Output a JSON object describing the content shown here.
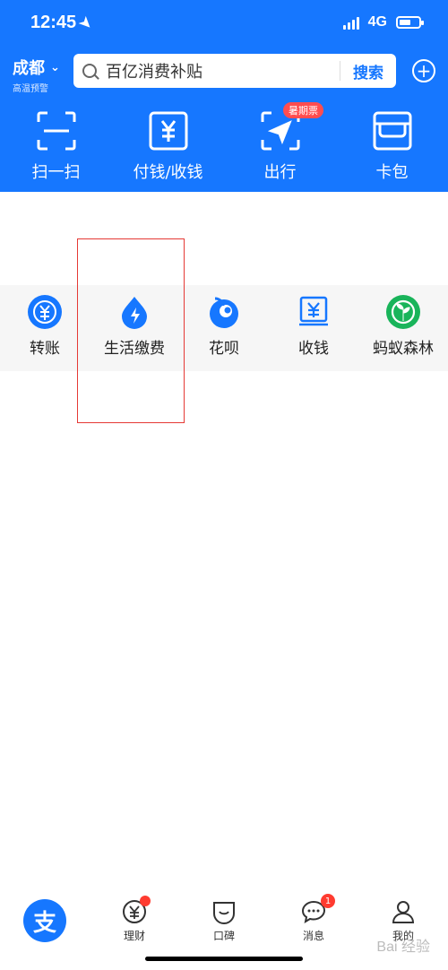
{
  "status_bar": {
    "time": "12:45",
    "network": "4G"
  },
  "header": {
    "city": "成都",
    "city_sub": "高温预警",
    "search_placeholder": "百亿消费补贴",
    "search_button": "搜索"
  },
  "top_actions": [
    {
      "label": "扫一扫",
      "icon": "scan-icon"
    },
    {
      "label": "付钱/收钱",
      "icon": "pay-icon"
    },
    {
      "label": "出行",
      "icon": "travel-icon",
      "badge": "暑期票"
    },
    {
      "label": "卡包",
      "icon": "cardbag-icon"
    }
  ],
  "grid": [
    {
      "label": "转账",
      "icon": "transfer-icon"
    },
    {
      "label": "生活缴费",
      "icon": "bill-icon"
    },
    {
      "label": "花呗",
      "icon": "huabei-icon"
    },
    {
      "label": "收钱",
      "icon": "receive-icon"
    },
    {
      "label": "蚂蚁森林",
      "icon": "forest-icon"
    }
  ],
  "tabbar": [
    {
      "label": "",
      "icon": "alipay-home-icon",
      "glyph": "支"
    },
    {
      "label": "理财",
      "icon": "wealth-icon"
    },
    {
      "label": "口碑",
      "icon": "koubei-icon"
    },
    {
      "label": "消息",
      "icon": "message-icon",
      "badge": "1"
    },
    {
      "label": "我的",
      "icon": "profile-icon"
    }
  ],
  "watermark": "Bai 经验",
  "colors": {
    "brand": "#1677ff",
    "alert": "#ff4d4f",
    "forest": "#19b45a"
  }
}
